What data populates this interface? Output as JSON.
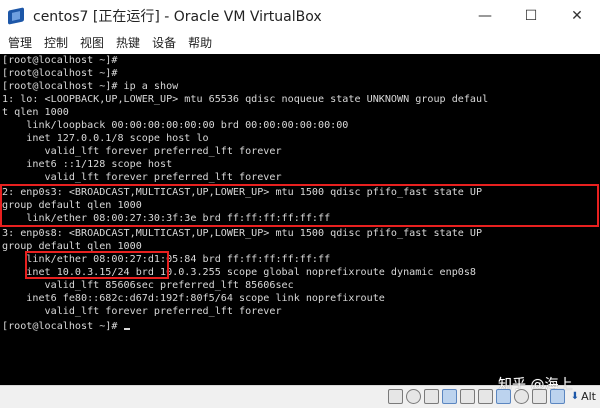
{
  "window": {
    "title": "centos7 [正在运行] - Oracle VM VirtualBox",
    "minimize": "—",
    "maximize": "☐",
    "close": "✕"
  },
  "menu": [
    "管理",
    "控制",
    "视图",
    "热键",
    "设备",
    "帮助"
  ],
  "terminal": {
    "lines": [
      "[root@localhost ~]#",
      "[root@localhost ~]#",
      "[root@localhost ~]# ip a show",
      "1: lo: <LOOPBACK,UP,LOWER_UP> mtu 65536 qdisc noqueue state UNKNOWN group defaul",
      "t qlen 1000",
      "    link/loopback 00:00:00:00:00:00 brd 00:00:00:00:00:00",
      "    inet 127.0.0.1/8 scope host lo",
      "       valid_lft forever preferred_lft forever",
      "    inet6 ::1/128 scope host",
      "       valid_lft forever preferred_lft forever",
      "2: enp0s3: <BROADCAST,MULTICAST,UP,LOWER_UP> mtu 1500 qdisc pfifo_fast state UP",
      "group default qlen 1000",
      "    link/ether 08:00:27:30:3f:3e brd ff:ff:ff:ff:ff:ff",
      "3: enp0s8: <BROADCAST,MULTICAST,UP,LOWER_UP> mtu 1500 qdisc pfifo_fast state UP",
      "group default qlen 1000",
      "    link/ether 08:00:27:d1:05:84 brd ff:ff:ff:ff:ff:ff",
      "    inet 10.0.3.15/24 brd 10.0.3.255 scope global noprefixroute dynamic enp0s8",
      "       valid_lft 85606sec preferred_lft 85606sec",
      "    inet6 fe80::682c:d67d:192f:80f5/64 scope link noprefixroute",
      "       valid_lft forever preferred_lft forever",
      "[root@localhost ~]# "
    ],
    "background": "#000000",
    "foreground": "#d8d8d8"
  },
  "highlight_color": "#e8201f",
  "statusbar": {
    "watermark": "知乎 @海上",
    "host_key": "Alt",
    "tray_icons": [
      "hard-disk-icon",
      "optical-drive-icon",
      "audio-icon",
      "network-icon",
      "usb-icon",
      "shared-folder-icon",
      "display-icon",
      "video-capture-icon",
      "cpu-icon",
      "mouse-integration-icon"
    ]
  }
}
